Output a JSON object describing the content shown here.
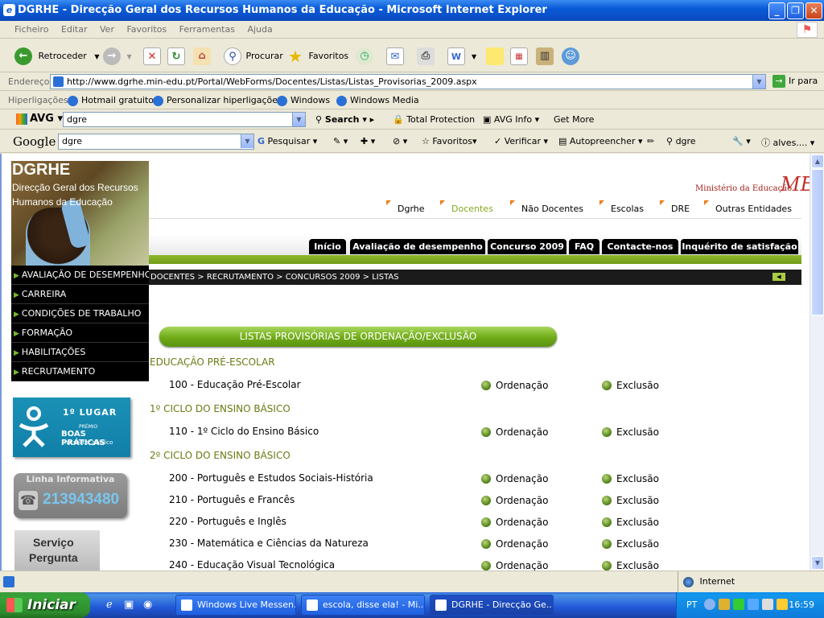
{
  "window": {
    "title": "DGRHE - Direcção Geral dos Recursos Humanos da Educação - Microsoft Internet Explorer"
  },
  "menu": [
    "Ficheiro",
    "Editar",
    "Ver",
    "Favoritos",
    "Ferramentas",
    "Ajuda"
  ],
  "toolbar": {
    "back": "Retroceder",
    "search": "Procurar",
    "favorites": "Favoritos"
  },
  "address": {
    "label": "Endereço",
    "url": "http://www.dgrhe.min-edu.pt/Portal/WebForms/Docentes/Listas/Listas_Provisorias_2009.aspx",
    "go": "Ir para"
  },
  "links": {
    "label": "Hiperligações",
    "items": [
      "Hotmail gratuito",
      "Personalizar hiperligações",
      "Windows",
      "Windows Media"
    ]
  },
  "avg": {
    "logo": "AVG",
    "query": "dgre",
    "search": "Search",
    "protection": "Total Protection",
    "info": "AVG Info",
    "more": "Get More"
  },
  "google": {
    "logo": "Google",
    "query": "dgre",
    "pesquisar": "Pesquisar",
    "favoritos": "Favoritos",
    "verificar": "Verificar",
    "auto": "Autopreencher",
    "dgre": "dgre",
    "user": "alves...."
  },
  "page": {
    "brand_title": "DGRHE",
    "brand_sub": "Direcção Geral dos Recursos Humanos da Educação",
    "ministry": "Ministério da Educação",
    "ministry_logo": "ME",
    "topnav": [
      "Dgrhe",
      "Docentes",
      "Não Docentes",
      "Escolas",
      "DRE",
      "Outras Entidades"
    ],
    "tabs": [
      "Início",
      "Avaliação de desempenho",
      "Concurso 2009",
      "FAQ",
      "Contacte-nos",
      "Inquérito de satisfação"
    ],
    "breadcrumb": "DOCENTES > RECRUTAMENTO > CONCURSOS 2009 > LISTAS",
    "leftnav": [
      "AVALIAÇÃO DE DESEMPENHO",
      "CARREIRA",
      "CONDIÇÕES DE TRABALHO",
      "FORMAÇÃO",
      "HABILITAÇÕES",
      "RECRUTAMENTO"
    ],
    "award": {
      "place": "1º LUGAR",
      "premio": "PRÉMIO",
      "title": "BOAS PRÁTICAS",
      "sub": "no sector público"
    },
    "linha": {
      "title": "Linha Informativa",
      "number": "213943480"
    },
    "servico": {
      "line1": "Serviço",
      "line2": "Pergunta"
    },
    "heading": "LISTAS PROVISÓRIAS DE ORDENAÇÃO/EXCLUSÃO",
    "sections": [
      {
        "title": "EDUCAÇÃO PRÉ-ESCOLAR",
        "rows": [
          "100 - Educação Pré-Escolar"
        ]
      },
      {
        "title": "1º CICLO DO ENSINO BÁSICO",
        "rows": [
          "110 - 1º Ciclo do Ensino Básico"
        ]
      },
      {
        "title": "2º CICLO DO ENSINO BÁSICO",
        "rows": [
          "200 - Português e Estudos Sociais-História",
          "210 - Português e Francês",
          "220 - Português e Inglês",
          "230 - Matemática e Ciências da Natureza",
          "240 - Educação Visual Tecnológica"
        ]
      }
    ],
    "ordenacao": "Ordenação",
    "exclusao": "Exclusão"
  },
  "status": {
    "zone": "Internet"
  },
  "taskbar": {
    "start": "Iniciar",
    "tasks": [
      "Windows Live Messen...",
      "escola, disse ela! - Mi...",
      "DGRHE - Direcção Ge..."
    ],
    "lang": "PT",
    "clock": "16:59"
  }
}
